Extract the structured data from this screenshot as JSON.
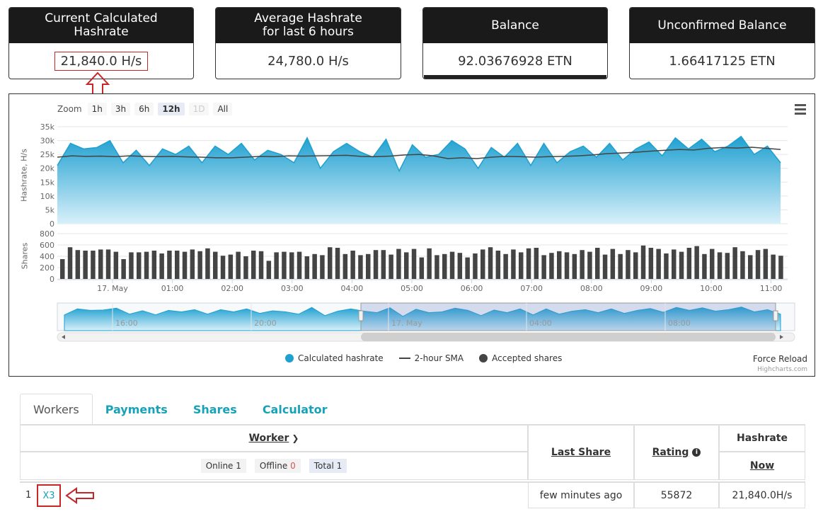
{
  "stats": [
    {
      "title": "Current Calculated\nHashrate",
      "value": "21,840.0 H/s"
    },
    {
      "title": "Average Hashrate\nfor last 6 hours",
      "value": "24,780.0 H/s"
    },
    {
      "title": "Balance",
      "value": "92.03676928 ETN"
    },
    {
      "title": "Unconfirmed Balance",
      "value": "1.66417125 ETN"
    }
  ],
  "chart": {
    "zoom_label": "Zoom",
    "zoom_buttons": [
      "1h",
      "3h",
      "6h",
      "12h",
      "1D",
      "All"
    ],
    "selected_zoom": "12h",
    "ylabel_top": "Hashrate, H/s",
    "ylabel_bottom": "Shares",
    "legend": [
      "Calculated hashrate",
      "2-hour SMA",
      "Accepted shares"
    ],
    "force_reload": "Force Reload",
    "credit": "Highcharts.com",
    "nav_labels": [
      "16:00",
      "20:00",
      "17. May",
      "04:00",
      "08:00"
    ],
    "colors": {
      "area": "#1fa0d0",
      "sma": "#444444",
      "bars": "#444444"
    }
  },
  "chart_data": [
    {
      "type": "area",
      "ylabel": "Hashrate, H/s",
      "yticks": [
        "0",
        "5k",
        "10k",
        "15k",
        "20k",
        "25k",
        "30k",
        "35k"
      ],
      "ylim": [
        0,
        35000
      ],
      "xticks": [
        "17. May",
        "01:00",
        "02:00",
        "03:00",
        "04:00",
        "05:00",
        "06:00",
        "07:00",
        "08:00",
        "09:00",
        "10:00",
        "11:00"
      ],
      "series": [
        {
          "name": "Calculated hashrate",
          "values": [
            21000,
            29000,
            27000,
            27500,
            30000,
            22000,
            26500,
            21000,
            27000,
            25000,
            28000,
            22000,
            28000,
            25000,
            29000,
            23000,
            26500,
            25000,
            22000,
            31000,
            20000,
            26000,
            29000,
            26000,
            24000,
            30500,
            19000,
            28500,
            24000,
            25000,
            30000,
            27000,
            20000,
            27500,
            24000,
            29000,
            21000,
            29000,
            22000,
            26000,
            28000,
            24000,
            29000,
            23000,
            27000,
            29500,
            24500,
            31000,
            27000,
            30500,
            26000,
            28000,
            31500,
            25000,
            28000,
            22000
          ]
        },
        {
          "name": "2-hour SMA",
          "values": [
            24000,
            24500,
            24300,
            24400,
            24200,
            24500,
            24300,
            24200,
            24300,
            24100,
            24000,
            23800,
            23800,
            24000,
            24300,
            24200,
            24500,
            24400,
            24500,
            24600,
            24700,
            24300,
            24200,
            24400,
            24800,
            25000,
            24500,
            23500,
            23800,
            23500,
            24000,
            24300,
            24200,
            24000,
            24200,
            24300,
            24500,
            24800,
            25300,
            25500,
            25800,
            26200,
            26500,
            26800,
            26600,
            27200,
            27500,
            27300,
            27600,
            27200,
            26800
          ]
        }
      ]
    },
    {
      "type": "bar",
      "ylabel": "Shares",
      "yticks": [
        "0",
        "200",
        "400",
        "600",
        "800"
      ],
      "ylim": [
        0,
        800
      ],
      "series": [
        {
          "name": "Accepted shares",
          "values": [
            350,
            560,
            510,
            500,
            500,
            520,
            520,
            480,
            350,
            470,
            470,
            480,
            500,
            450,
            500,
            500,
            480,
            520,
            490,
            540,
            480,
            410,
            430,
            480,
            400,
            500,
            490,
            320,
            470,
            480,
            470,
            480,
            400,
            440,
            420,
            560,
            550,
            440,
            500,
            420,
            440,
            510,
            510,
            430,
            530,
            470,
            530,
            380,
            540,
            420,
            440,
            480,
            460,
            380,
            450,
            520,
            560,
            500,
            440,
            520,
            470,
            540,
            550,
            420,
            460,
            490,
            470,
            440,
            510,
            480,
            550,
            430,
            530,
            440,
            510,
            470,
            590,
            550,
            530,
            450,
            520,
            480,
            550,
            580,
            440,
            530,
            470,
            460,
            560,
            490,
            420,
            510,
            530,
            430,
            410
          ]
        }
      ]
    }
  ],
  "tabs": [
    "Workers",
    "Payments",
    "Shares",
    "Calculator"
  ],
  "table": {
    "worker_header": "Worker",
    "last_share_header": "Last Share",
    "rating_header": "Rating",
    "hashrate_header": "Hashrate",
    "now_header": "Now",
    "filter_online": "Online",
    "online_count": "1",
    "filter_offline": "Offline",
    "offline_count": "0",
    "filter_total": "Total",
    "total_count": "1",
    "rows": [
      {
        "index": "1",
        "worker": "X3",
        "last_share": "few minutes ago",
        "rating": "55872",
        "hashrate": "21,840.0H/s"
      }
    ]
  }
}
